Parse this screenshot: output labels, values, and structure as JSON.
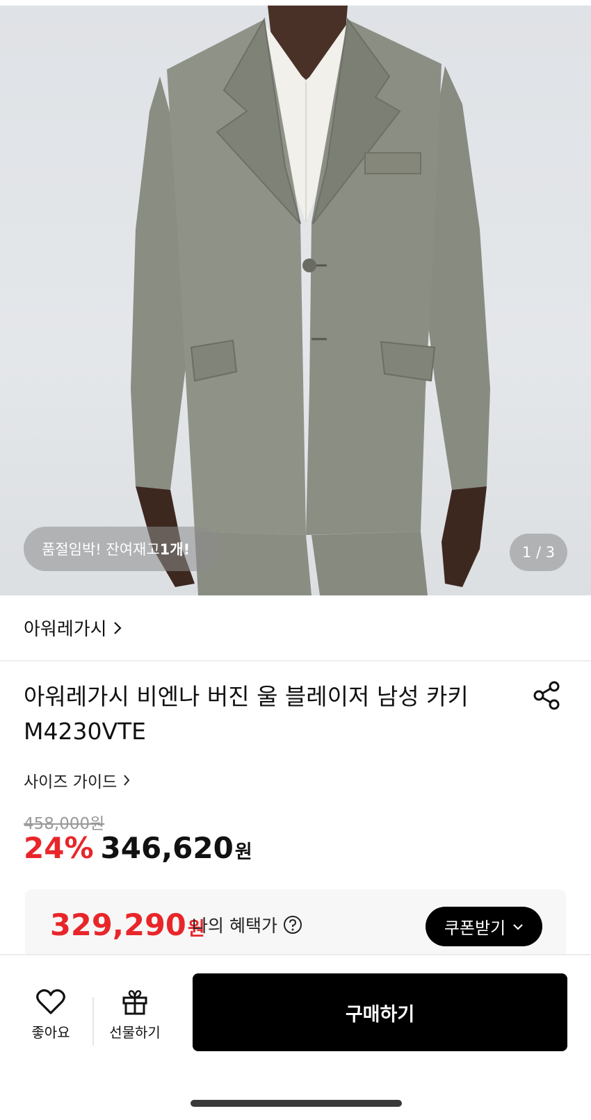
{
  "hero": {
    "stock_prefix": "품절임박! 잔여재고 ",
    "stock_count": "1개!",
    "page_current": "1",
    "page_separator": " / ",
    "page_total": "3"
  },
  "brand": {
    "name": "아워레가시"
  },
  "product": {
    "title_line1": "아워레가시 비엔나 버진 울 블레이저 남성 카키",
    "title_line2": "M4230VTE",
    "size_guide": "사이즈 가이드"
  },
  "price": {
    "original": "458,000원",
    "discount": "24%",
    "sale": "346,620",
    "currency": "원"
  },
  "benefit": {
    "price": "329,290",
    "currency": "원",
    "label": "나의 혜택가",
    "coupon_button": "쿠폰받기"
  },
  "bottom_bar": {
    "like_label": "좋아요",
    "gift_label": "선물하기",
    "buy_label": "구매하기"
  },
  "colors": {
    "accent_red": "#e8262a",
    "button_black": "#000000",
    "jacket_khaki": "#8c8f85"
  },
  "icons": [
    "chevron-right-icon",
    "share-icon",
    "question-circle-icon",
    "chevron-down-icon",
    "heart-icon",
    "gift-icon"
  ]
}
